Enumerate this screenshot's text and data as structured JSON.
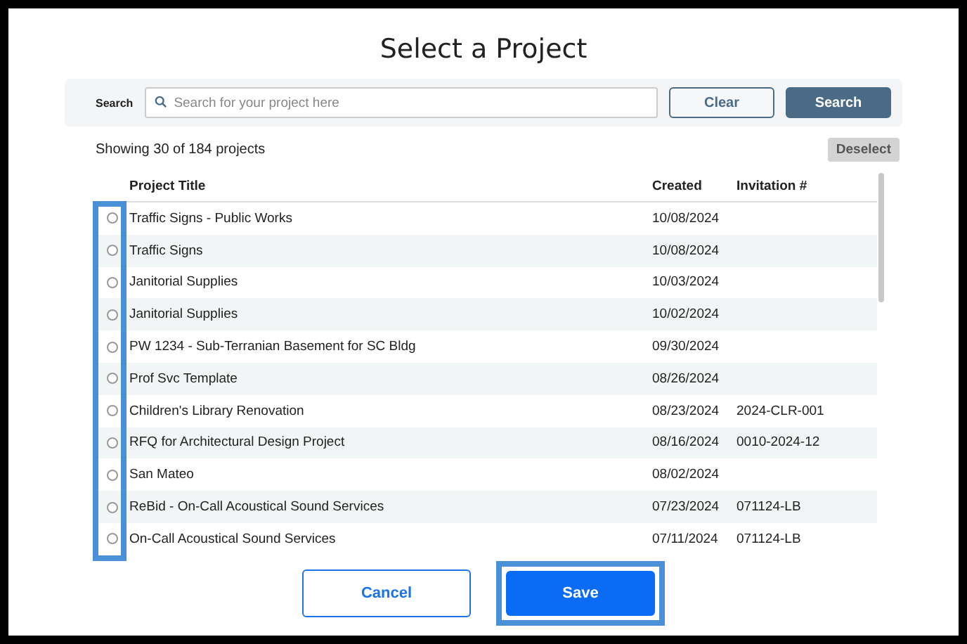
{
  "dialog": {
    "title": "Select a Project"
  },
  "search": {
    "label": "Search",
    "placeholder": "Search for your project here",
    "clear_button": "Clear",
    "search_button": "Search"
  },
  "summary": "Showing 30 of 184 projects",
  "deselect_button": "Deselect",
  "table": {
    "columns": [
      "Project Title",
      "Created",
      "Invitation #"
    ],
    "rows": [
      {
        "title": "Traffic Signs - Public Works",
        "created": "10/08/2024",
        "invitation": "",
        "selected": false
      },
      {
        "title": "Traffic Signs",
        "created": "10/08/2024",
        "invitation": "",
        "selected": false
      },
      {
        "title": "Janitorial Supplies",
        "created": "10/03/2024",
        "invitation": "",
        "selected": false
      },
      {
        "title": "Janitorial Supplies",
        "created": "10/02/2024",
        "invitation": "",
        "selected": false
      },
      {
        "title": "PW 1234 - Sub-Terranian Basement for SC Bldg",
        "created": "09/30/2024",
        "invitation": "",
        "selected": false
      },
      {
        "title": "Prof Svc Template",
        "created": "08/26/2024",
        "invitation": "",
        "selected": false
      },
      {
        "title": "Children's Library Renovation",
        "created": "08/23/2024",
        "invitation": "2024-CLR-001",
        "selected": false
      },
      {
        "title": "RFQ for Architectural Design Project",
        "created": "08/16/2024",
        "invitation": "0010-2024-12",
        "selected": false
      },
      {
        "title": "San Mateo",
        "created": "08/02/2024",
        "invitation": "",
        "selected": false
      },
      {
        "title": "ReBid - On-Call Acoustical Sound Services",
        "created": "07/23/2024",
        "invitation": "071124-LB",
        "selected": false
      },
      {
        "title": "On-Call Acoustical Sound Services",
        "created": "07/11/2024",
        "invitation": "071124-LB",
        "selected": false
      }
    ]
  },
  "buttons": {
    "cancel": "Cancel",
    "save": "Save"
  }
}
